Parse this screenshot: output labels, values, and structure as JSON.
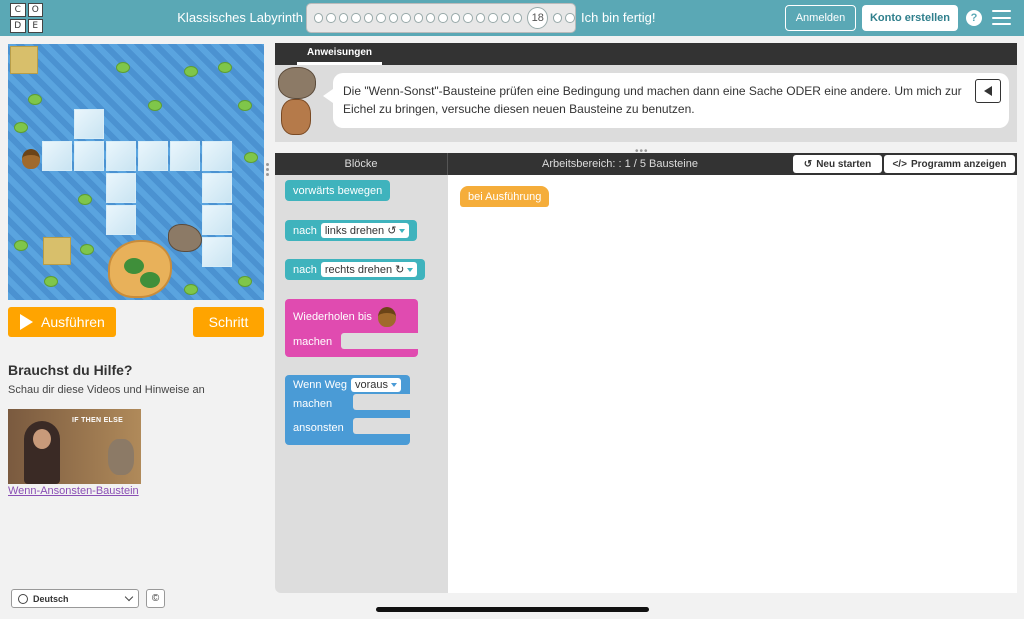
{
  "header": {
    "logo_letters": [
      "C",
      "O",
      "D",
      "E"
    ],
    "level_title": "Klassisches Labyrinth",
    "current_level": "18",
    "finished_label": "Ich bin fertig!",
    "login_label": "Anmelden",
    "signup_label": "Konto erstellen",
    "help_label": "?"
  },
  "left": {
    "run_label": "Ausführen",
    "step_label": "Schritt",
    "help_heading": "Brauchst du Hilfe?",
    "help_sub": "Schau dir diese Videos und Hinweise an",
    "video_thumb_text": "IF THEN ELSE",
    "video_link": "Wenn-Ansonsten-Baustein",
    "language": "Deutsch",
    "copyright": "©"
  },
  "instructions": {
    "tab_label": "Anweisungen",
    "text": "Die \"Wenn-Sonst\"-Bausteine prüfen eine Bedingung und machen dann eine Sache ODER eine andere. Um mich zur Eichel zu bringen, versuche diesen neuen Bausteine zu benutzen."
  },
  "workspace": {
    "blocks_title": "Blöcke",
    "workspace_title": "Arbeitsbereich: : 1 / 5 Bausteine",
    "restart_label": "Neu starten",
    "show_code_label": "Programm anzeigen",
    "when_run": "bei Ausführung"
  },
  "toolbox": {
    "move_forward": "vorwärts bewegen",
    "turn_prefix": "nach",
    "turn_left": "links drehen ↺",
    "turn_right": "rechts drehen ↻",
    "repeat_until": "Wiederholen bis",
    "do_label": "machen",
    "if_path": "Wenn Weg",
    "direction": "voraus",
    "if_do": "machen",
    "else_label": "ansonsten"
  }
}
